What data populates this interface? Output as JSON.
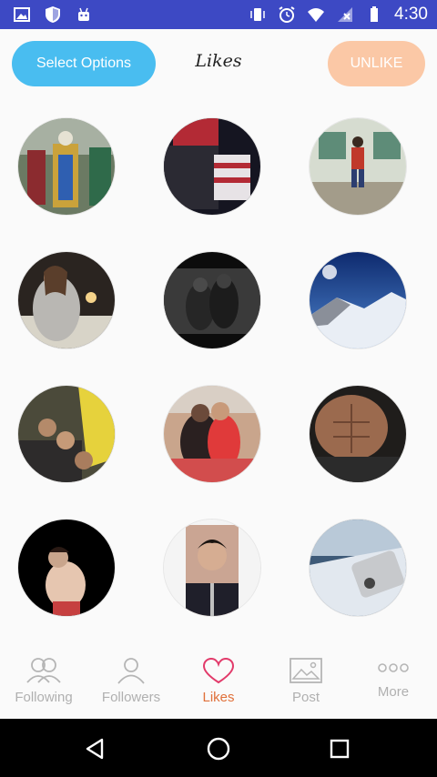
{
  "status_bar": {
    "time": "4:30",
    "icons_left": [
      "image-icon",
      "shield-icon",
      "android-icon"
    ],
    "icons_right": [
      "vibrate-icon",
      "alarm-icon",
      "wifi-icon",
      "signal-icon",
      "battery-icon"
    ],
    "background_color": "#3d49c4"
  },
  "header": {
    "select_options_label": "Select Options",
    "title": "Likes",
    "unlike_label": "UNLIKE",
    "select_color": "#49bdf0",
    "unlike_color": "#fbc8a6"
  },
  "grid": {
    "items": [
      {
        "name": "liked-photo-1"
      },
      {
        "name": "liked-photo-2"
      },
      {
        "name": "liked-photo-3"
      },
      {
        "name": "liked-photo-4"
      },
      {
        "name": "liked-photo-5"
      },
      {
        "name": "liked-photo-6"
      },
      {
        "name": "liked-photo-7"
      },
      {
        "name": "liked-photo-8"
      },
      {
        "name": "liked-photo-9"
      },
      {
        "name": "liked-photo-10"
      },
      {
        "name": "liked-photo-11"
      },
      {
        "name": "liked-photo-12"
      }
    ]
  },
  "tabs": [
    {
      "label": "Following",
      "icon": "following-icon",
      "active": false
    },
    {
      "label": "Followers",
      "icon": "followers-icon",
      "active": false
    },
    {
      "label": "Likes",
      "icon": "heart-icon",
      "active": true
    },
    {
      "label": "Post",
      "icon": "image-icon",
      "active": false
    },
    {
      "label": "More",
      "icon": "more-icon",
      "active": false
    }
  ],
  "nav_bar": {
    "buttons": [
      "back-icon",
      "home-icon",
      "recents-icon"
    ]
  }
}
